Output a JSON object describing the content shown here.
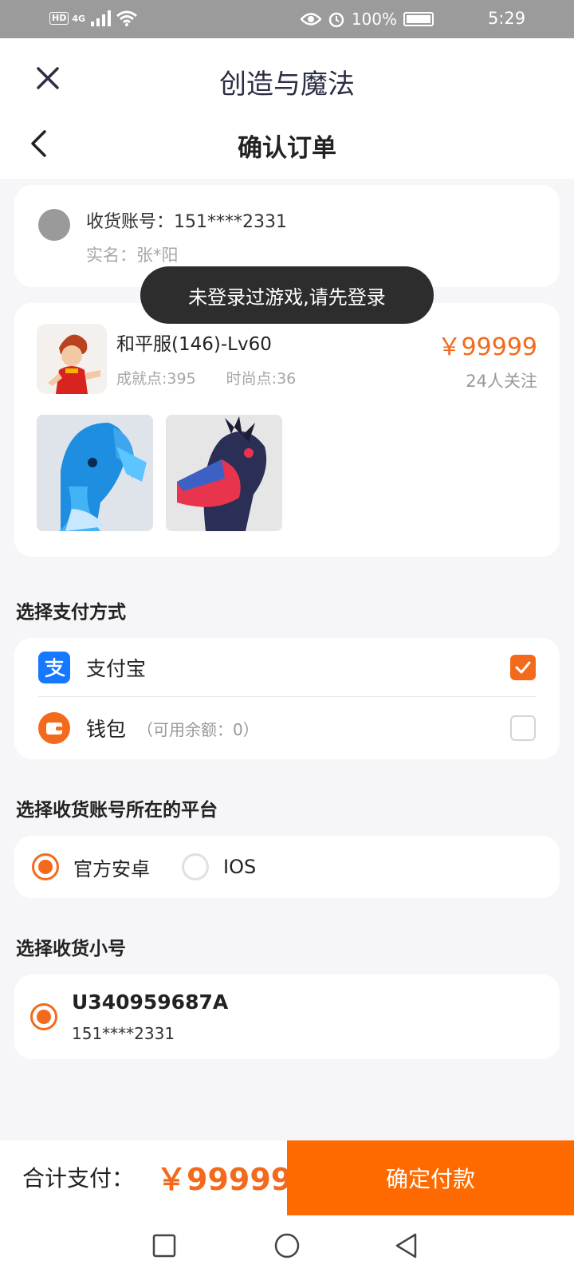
{
  "status_bar": {
    "network_badge": "HD",
    "network_type": "4G",
    "battery": "100%",
    "time": "5:29",
    "icons": [
      "signal-icon",
      "wifi-icon",
      "eye-icon",
      "alarm-icon",
      "battery-icon"
    ]
  },
  "header": {
    "app_title": "创造与魔法",
    "page_title": "确认订单",
    "close_icon": "close-icon",
    "back_icon": "back-icon"
  },
  "account": {
    "label": "收货账号：151****2331",
    "real_name": "实名：张*阳"
  },
  "toast": {
    "message": "未登录过游戏,请先登录"
  },
  "item": {
    "title": "和平服(146)-Lv60",
    "achievement": "成就点:395",
    "fashion": "时尚点:36",
    "price": "￥99999",
    "followers": "24人关注"
  },
  "payment": {
    "section_title": "选择支付方式",
    "options": [
      {
        "label": "支付宝",
        "note": "",
        "checked": true,
        "icon": "alipay-icon",
        "color": "#1677ff"
      },
      {
        "label": "钱包",
        "note": "（可用余额：0）",
        "checked": false,
        "icon": "wallet-icon",
        "color": "#f36a1c"
      }
    ]
  },
  "platform": {
    "section_title": "选择收货账号所在的平台",
    "options": [
      {
        "label": "官方安卓",
        "selected": true
      },
      {
        "label": "IOS",
        "selected": false
      }
    ]
  },
  "sub_account": {
    "section_title": "选择收货小号",
    "id": "U340959687A",
    "phone": "151****2331",
    "selected": true
  },
  "footer": {
    "total_label": "合计支付：",
    "total_value": "￥99999",
    "pay_button": "确定付款"
  },
  "colors": {
    "accent": "#f36a1c",
    "pay_button": "#ff6a00",
    "alipay": "#1677ff",
    "toast_bg": "#2d2d2d"
  }
}
